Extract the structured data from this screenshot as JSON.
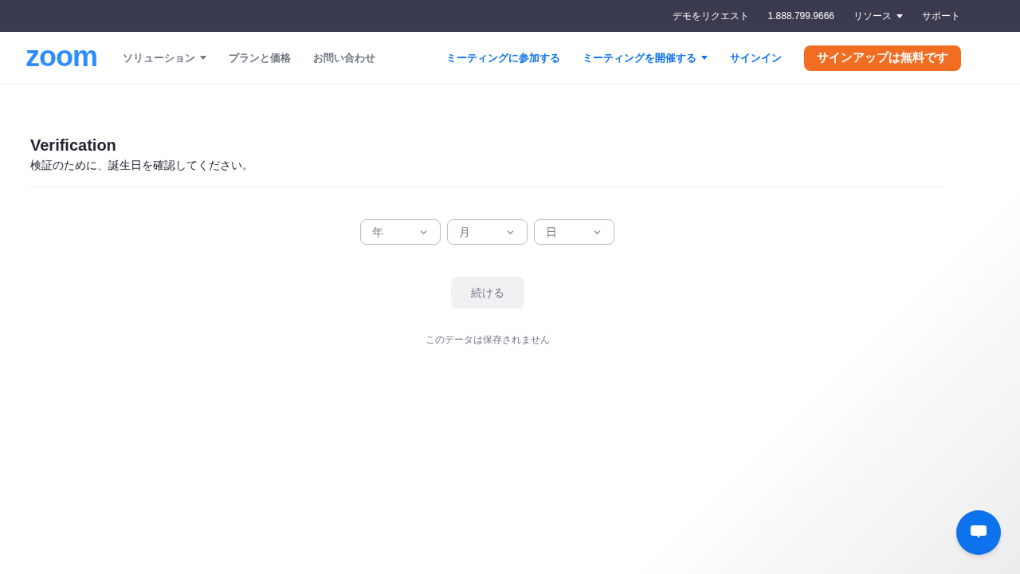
{
  "top_bar": {
    "links": [
      {
        "label": "デモをリクエスト",
        "dropdown": false
      },
      {
        "label": "1.888.799.9666",
        "dropdown": false
      },
      {
        "label": "リソース",
        "dropdown": true
      },
      {
        "label": "サポート",
        "dropdown": false
      }
    ]
  },
  "header": {
    "logo": "zoom",
    "nav_left": [
      {
        "label": "ソリューション",
        "dropdown": true
      },
      {
        "label": "プランと価格",
        "dropdown": false
      },
      {
        "label": "お問い合わせ",
        "dropdown": false
      }
    ],
    "nav_right": [
      {
        "label": "ミーティングに参加する",
        "dropdown": false
      },
      {
        "label": "ミーティングを開催する",
        "dropdown": true
      },
      {
        "label": "サインイン",
        "dropdown": false
      }
    ],
    "cta": "サインアップは無料です"
  },
  "verification": {
    "title": "Verification",
    "subtitle": "検証のために、誕生日を確認してください。",
    "selects": [
      {
        "placeholder": "年"
      },
      {
        "placeholder": "月"
      },
      {
        "placeholder": "日"
      }
    ],
    "continue_button": {
      "label": "続ける",
      "disabled": true
    },
    "note": "このデータは保存されません"
  }
}
